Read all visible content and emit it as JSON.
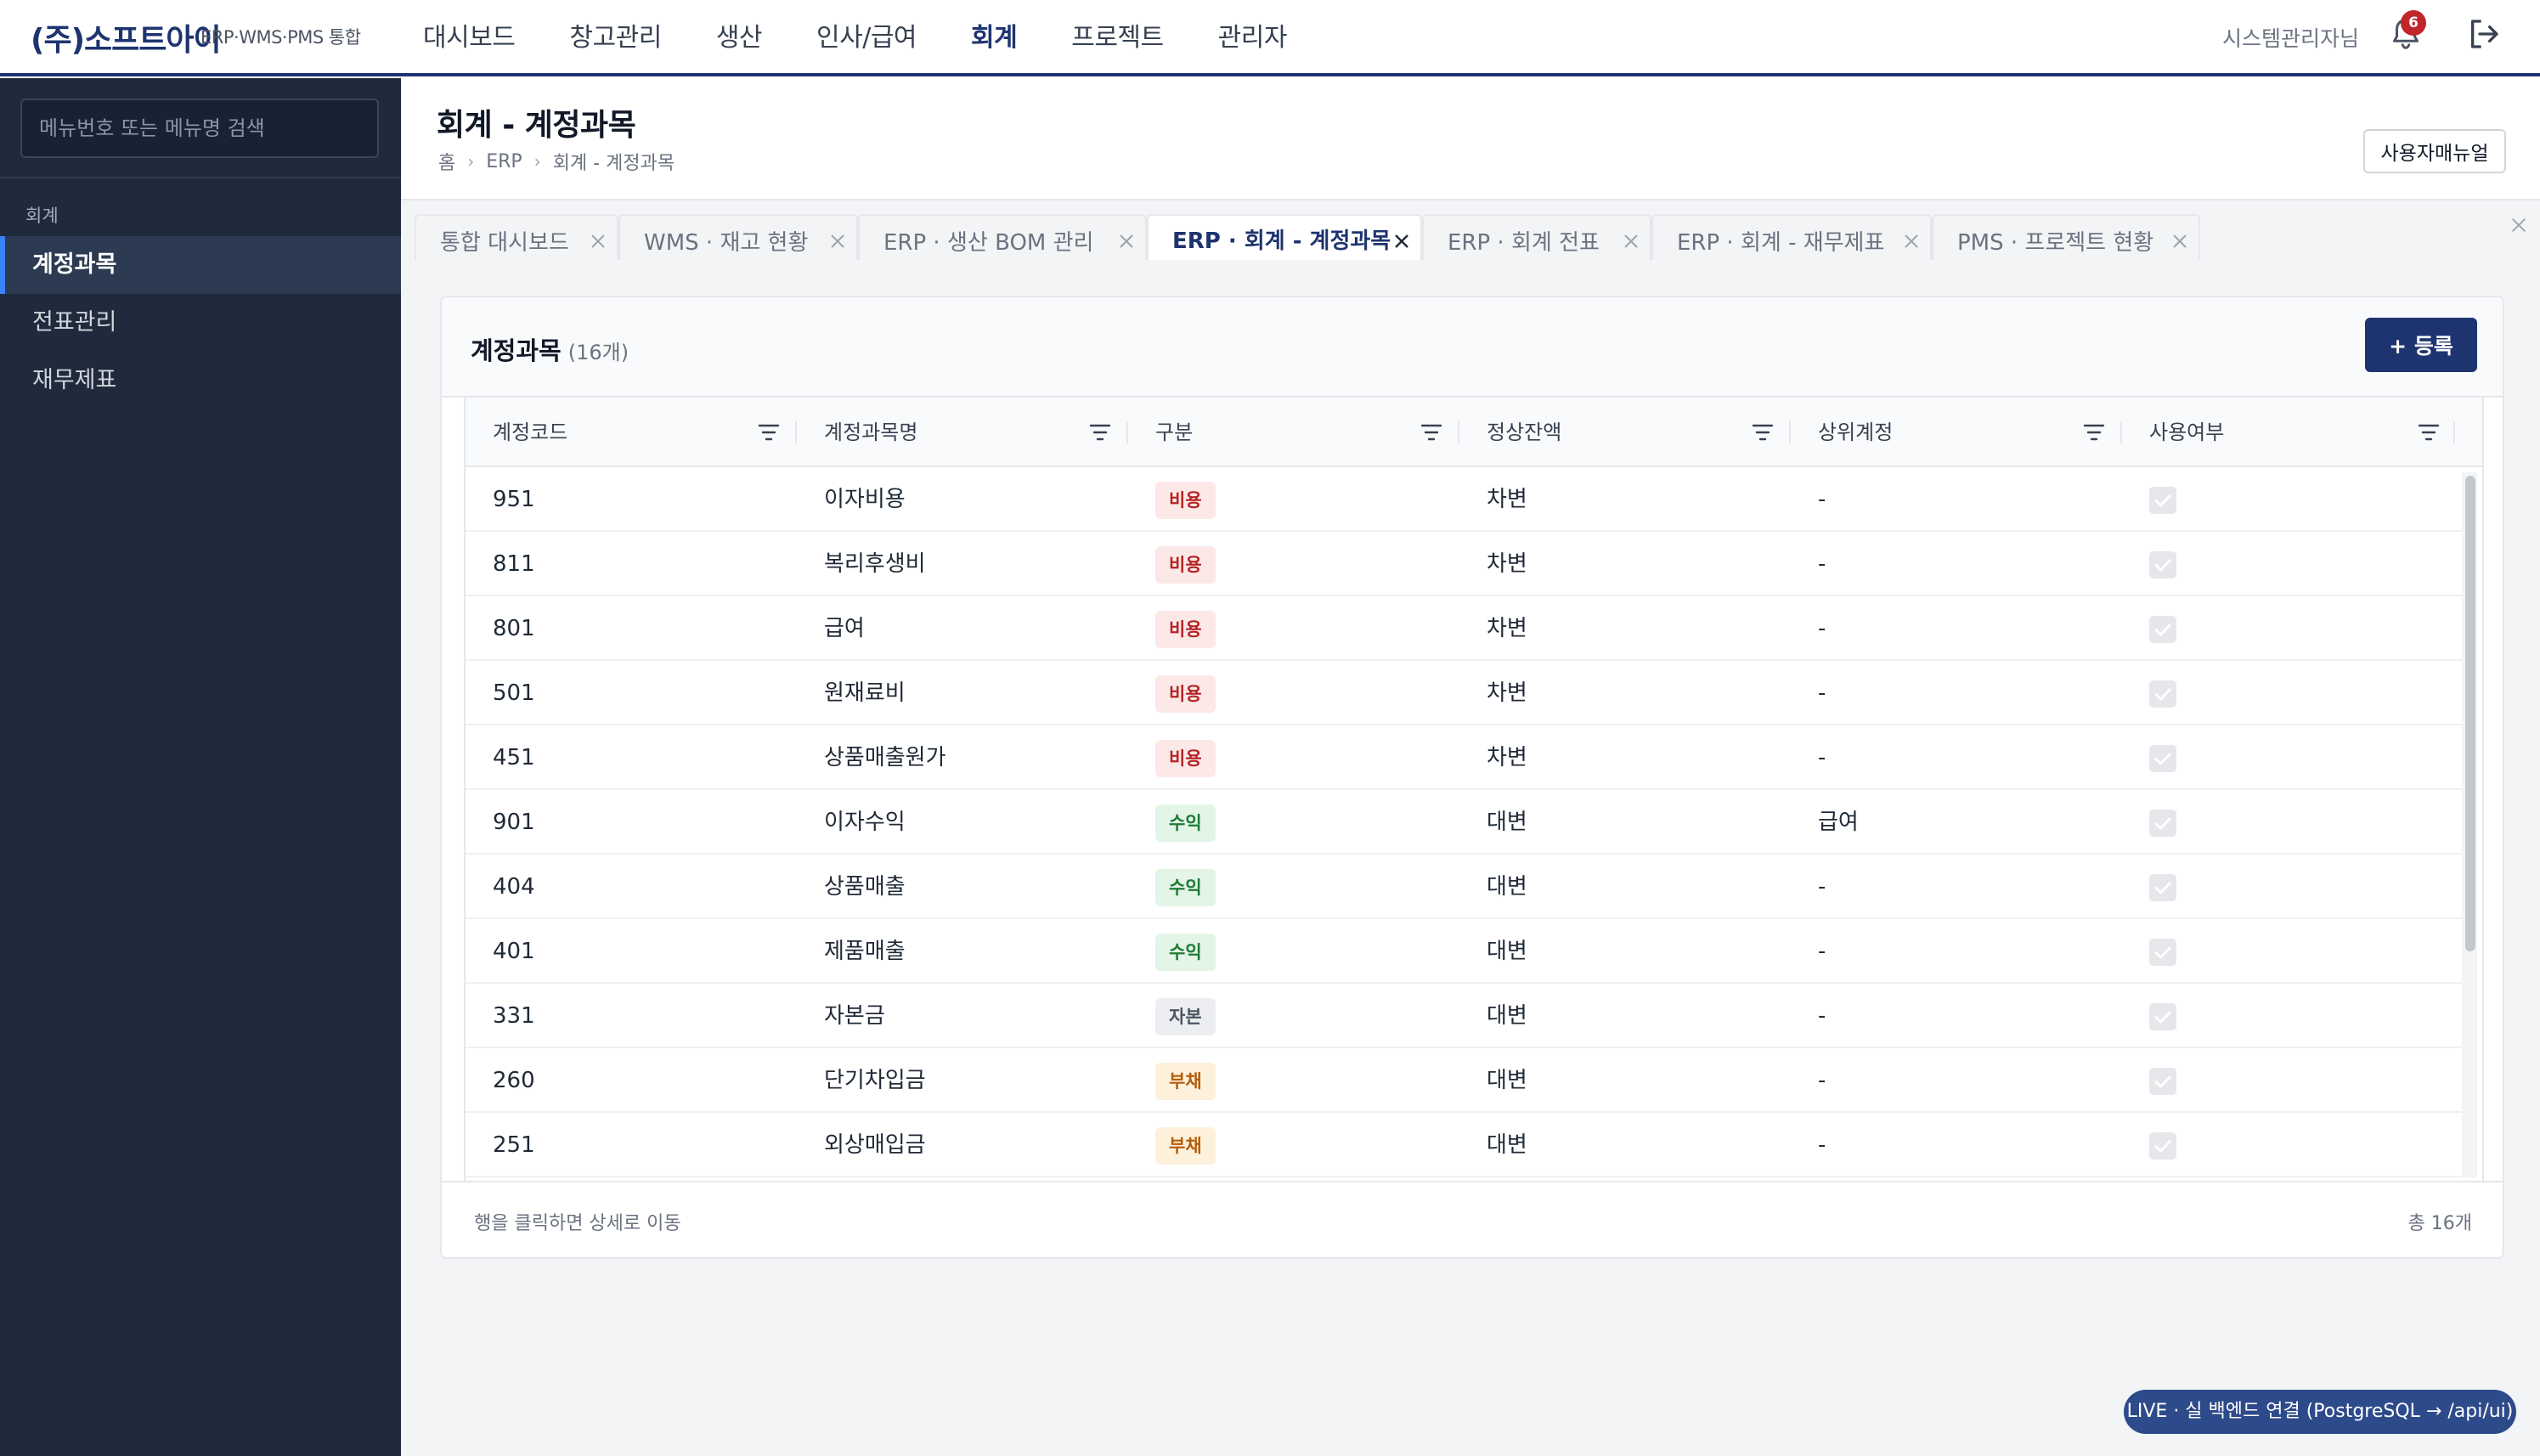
{
  "brand": {
    "name": "(주)소프트아이",
    "subtitle": "ERP·WMS·PMS 통합"
  },
  "nav": [
    "대시보드",
    "창고관리",
    "생산",
    "인사/급여",
    "회계",
    "프로젝트",
    "관리자"
  ],
  "nav_active": "회계",
  "user": {
    "name": "시스템관리자님",
    "notifications": "6"
  },
  "sidebar": {
    "search_placeholder": "메뉴번호 또는 메뉴명 검색",
    "section": "회계",
    "items": [
      {
        "label": "계정과목",
        "active": true
      },
      {
        "label": "전표관리",
        "active": false
      },
      {
        "label": "재무제표",
        "active": false
      }
    ]
  },
  "page": {
    "title": "회계 - 계정과목",
    "breadcrumb": [
      "홈",
      "ERP",
      "회계 - 계정과목"
    ],
    "manual_button": "사용자매뉴얼"
  },
  "tabs": [
    {
      "label": "통합 대시보드",
      "active": false
    },
    {
      "label": "WMS · 재고 현황",
      "active": false
    },
    {
      "label": "ERP · 생산 BOM 관리",
      "active": false
    },
    {
      "label": "ERP · 회계 - 계정과목",
      "active": true
    },
    {
      "label": "ERP · 회계 전표",
      "active": false
    },
    {
      "label": "ERP · 회계 - 재무제표",
      "active": false
    },
    {
      "label": "PMS · 프로젝트 현황",
      "active": false
    }
  ],
  "card": {
    "title": "계정과목",
    "count": "(16개)",
    "add_button": "+ 등록",
    "footer_hint": "행을 클릭하면 상세로 이동",
    "footer_total": "총 16개"
  },
  "columns": [
    "계정코드",
    "계정과목명",
    "구분",
    "정상잔액",
    "상위계정",
    "사용여부"
  ],
  "badge_colors": {
    "비용": {
      "bg": "#fde8e8",
      "fg": "#b42323"
    },
    "수익": {
      "bg": "#e3f5e6",
      "fg": "#1f7a35"
    },
    "자본": {
      "bg": "#eceef1",
      "fg": "#4b5563"
    },
    "부채": {
      "bg": "#fdf1dc",
      "fg": "#b45d09"
    }
  },
  "rows": [
    {
      "code": "951",
      "name": "이자비용",
      "type": "비용",
      "balance": "차변",
      "parent": "-",
      "in_use": true
    },
    {
      "code": "811",
      "name": "복리후생비",
      "type": "비용",
      "balance": "차변",
      "parent": "-",
      "in_use": true
    },
    {
      "code": "801",
      "name": "급여",
      "type": "비용",
      "balance": "차변",
      "parent": "-",
      "in_use": true
    },
    {
      "code": "501",
      "name": "원재료비",
      "type": "비용",
      "balance": "차변",
      "parent": "-",
      "in_use": true
    },
    {
      "code": "451",
      "name": "상품매출원가",
      "type": "비용",
      "balance": "차변",
      "parent": "-",
      "in_use": true
    },
    {
      "code": "901",
      "name": "이자수익",
      "type": "수익",
      "balance": "대변",
      "parent": "급여",
      "in_use": true
    },
    {
      "code": "404",
      "name": "상품매출",
      "type": "수익",
      "balance": "대변",
      "parent": "-",
      "in_use": true
    },
    {
      "code": "401",
      "name": "제품매출",
      "type": "수익",
      "balance": "대변",
      "parent": "-",
      "in_use": true
    },
    {
      "code": "331",
      "name": "자본금",
      "type": "자본",
      "balance": "대변",
      "parent": "-",
      "in_use": true
    },
    {
      "code": "260",
      "name": "단기차입금",
      "type": "부채",
      "balance": "대변",
      "parent": "-",
      "in_use": true
    },
    {
      "code": "251",
      "name": "외상매입금",
      "type": "부채",
      "balance": "대변",
      "parent": "-",
      "in_use": true
    }
  ],
  "status_pill": "LIVE · 실 백엔드 연결 (PostgreSQL → /api/ui)"
}
